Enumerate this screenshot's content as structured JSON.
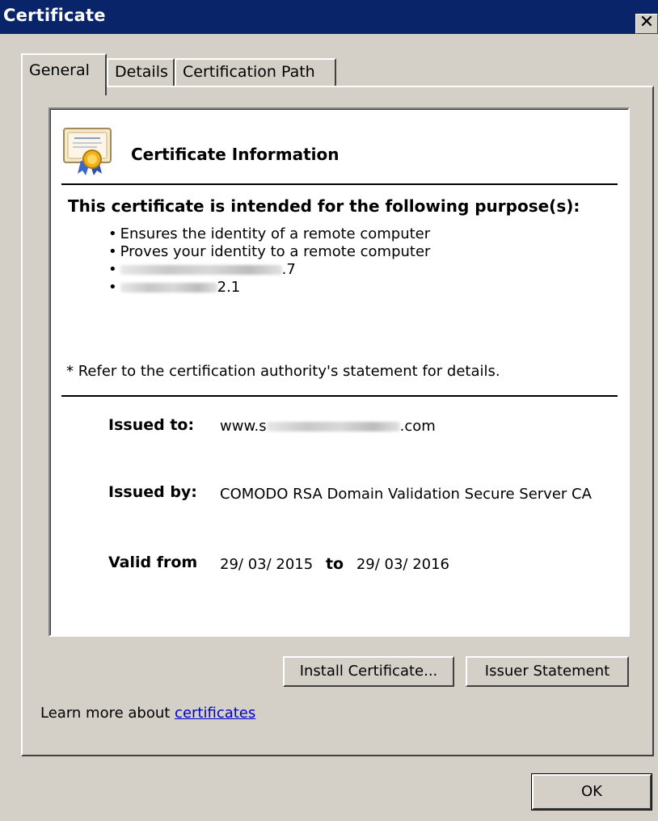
{
  "window": {
    "title": "Certificate",
    "close_glyph": "✕"
  },
  "tabs": [
    {
      "label": "General",
      "selected": true
    },
    {
      "label": "Details",
      "selected": false
    },
    {
      "label": "Certification Path",
      "selected": false
    }
  ],
  "info": {
    "icon": "certificate-icon",
    "heading": "Certificate Information",
    "purpose_heading": "This certificate is intended for the following purpose(s):",
    "purposes": [
      {
        "text": "Ensures the identity of a remote computer",
        "redacted": false
      },
      {
        "text": "Proves your identity to a remote computer",
        "redacted": false
      },
      {
        "text_suffix": ".7",
        "redacted": true
      },
      {
        "text_suffix": "2.1",
        "redacted": true
      }
    ],
    "bullet": "•",
    "note": "* Refer to the certification authority's statement for details."
  },
  "details": {
    "issued_to_label": "Issued to:",
    "issued_to_prefix": "www.s",
    "issued_to_suffix": ".com",
    "issued_by_label": "Issued by:",
    "issued_by_value": "COMODO RSA Domain Validation Secure Server CA",
    "valid_from_label": "Valid from",
    "valid_from": "29/ 03/ 2015",
    "to_label": "to",
    "valid_to": "29/ 03/ 2016"
  },
  "buttons": {
    "install": "Install Certificate...",
    "issuer_statement": "Issuer Statement",
    "ok": "OK"
  },
  "learn_more": {
    "text": "Learn more about",
    "link": "certificates"
  },
  "colors": {
    "titlebar": "#0a246a",
    "face": "#d4d0c8",
    "link": "#0000cc"
  }
}
